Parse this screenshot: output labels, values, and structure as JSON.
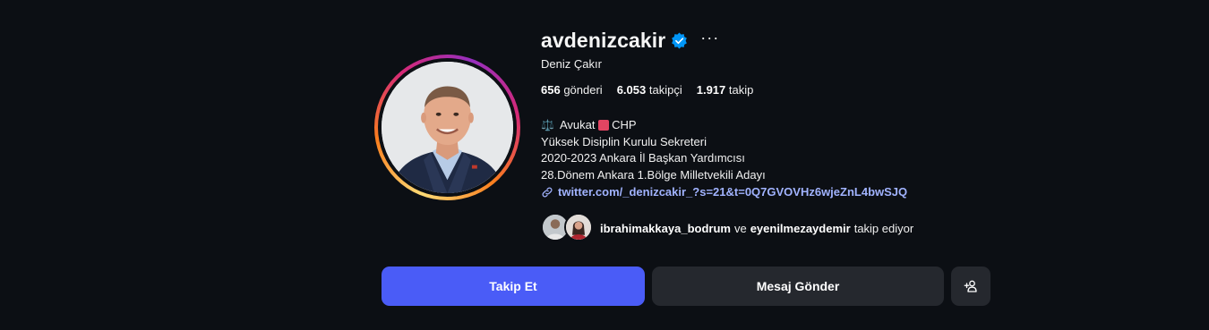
{
  "profile": {
    "username": "avdenizcakir",
    "full_name": "Deniz Çakır",
    "verified_icon": "verified-badge-icon",
    "more_icon": "···",
    "avatar": "profile-photo",
    "stats": {
      "posts_count": "656",
      "posts_label": "gönderi",
      "followers_count": "6.053",
      "followers_label": "takipçi",
      "following_count": "1.917",
      "following_label": "takip"
    },
    "bio": {
      "line1_emoji": "⚖️",
      "line1_text_a": "Avukat",
      "line1_text_b": "CHP",
      "line2": "Yüksek Disiplin Kurulu Sekreteri",
      "line3": "2020-2023 Ankara İl Başkan Yardımcısı",
      "line4": "28.Dönem Ankara 1.Bölge Milletvekili Adayı"
    },
    "link": "twitter.com/_denizcakir_?s=21&t=0Q7GVOVHz6wjeZnL4bwSJQ",
    "followed_by": {
      "user1": "ibrahimakkaya_bodrum",
      "connector": "ve",
      "user2": "eyenilmezaydemir",
      "suffix": "takip ediyor"
    }
  },
  "actions": {
    "follow_label": "Takip Et",
    "message_label": "Mesaj Gönder",
    "add_icon": "add-person-icon"
  },
  "colors": {
    "background": "#0c0f14",
    "follow_button": "#4a5cf7",
    "secondary_button": "#25282e",
    "link": "#a1b3ff",
    "verified": "#0095f6"
  }
}
